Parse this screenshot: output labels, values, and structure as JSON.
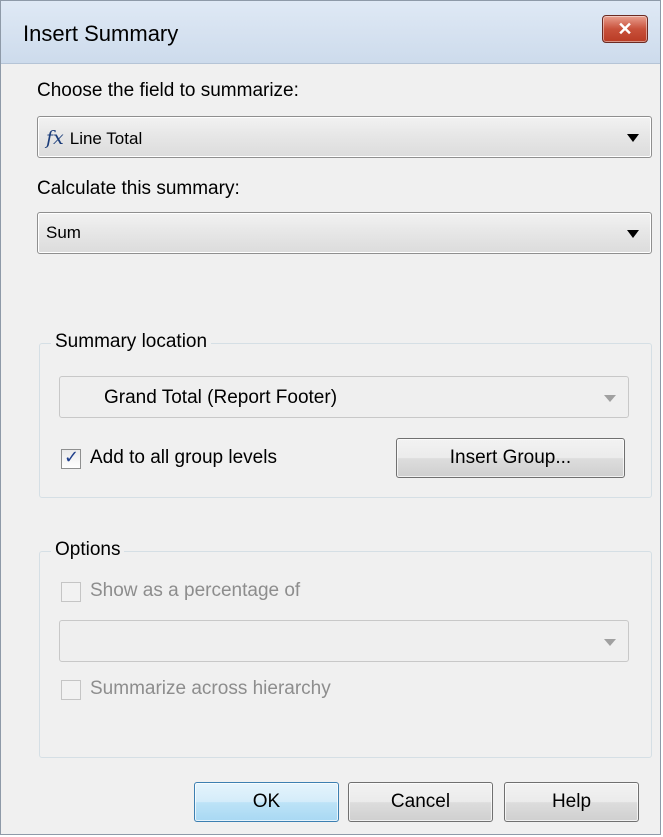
{
  "dialog": {
    "title": "Insert Summary",
    "close_label": "✕"
  },
  "field": {
    "label": "Choose the field to summarize:",
    "icon": "fx-icon",
    "selected": "Line Total"
  },
  "summary": {
    "label": "Calculate this summary:",
    "selected": "Sum"
  },
  "location": {
    "legend": "Summary location",
    "selected": "Grand Total (Report Footer)",
    "add_all_groups": {
      "label": "Add to all group levels",
      "checked": true
    },
    "insert_group_label": "Insert Group..."
  },
  "options": {
    "legend": "Options",
    "show_percentage": {
      "label": "Show as a percentage of",
      "checked": false,
      "enabled": false
    },
    "percentage_selected": "",
    "summarize_hierarchy": {
      "label": "Summarize across hierarchy",
      "checked": false,
      "enabled": false
    }
  },
  "buttons": {
    "ok": "OK",
    "cancel": "Cancel",
    "help": "Help"
  },
  "colors": {
    "close_button": "#c8513b",
    "default_button": "#bde3f7"
  }
}
